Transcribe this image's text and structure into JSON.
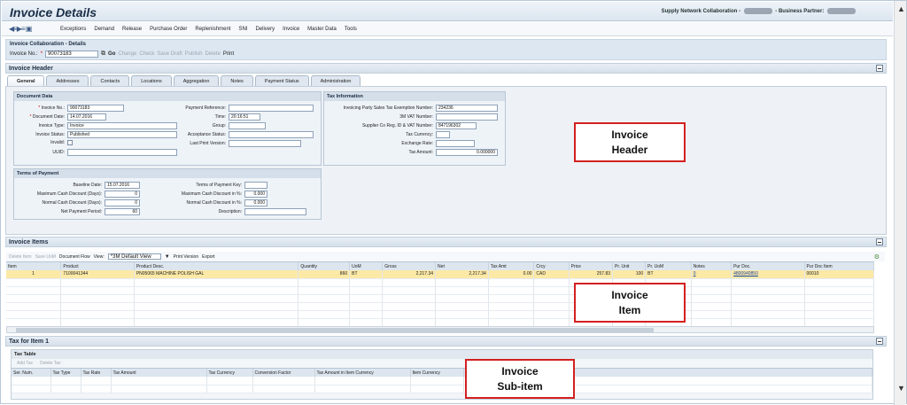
{
  "app": {
    "title": "Invoice Details",
    "snc_label": "Supply Network Collaboration -",
    "bp_label": "- Business Partner:"
  },
  "menu": [
    "Exceptions",
    "Demand",
    "Release",
    "Purchase Order",
    "Replenishment",
    "SNI",
    "Delivery",
    "Invoice",
    "Master Data",
    "Tools"
  ],
  "collab": {
    "header": "Invoice Collaboration - Details",
    "invoice_no_label": "Invoice No.:",
    "invoice_no_value": "90073183",
    "go": "Go",
    "actions": [
      "Change",
      "Check",
      "Save Draft",
      "Publish",
      "Delete"
    ],
    "print": "Print"
  },
  "invoice_header": {
    "title": "Invoice Header",
    "tabs": [
      "General",
      "Addresses",
      "Contacts",
      "Locations",
      "Aggregation",
      "Notes",
      "Payment Status",
      "Administration"
    ],
    "active_tab": "General",
    "document_data": {
      "title": "Document Data",
      "invoice_no_label": "Invoice No.:",
      "invoice_no": "90073183",
      "doc_date_label": "Document Date:",
      "doc_date": "14.07.2016",
      "invoice_type_label": "Invoice Type:",
      "invoice_type": "Invoice",
      "invoice_status_label": "Invoice Status:",
      "invoice_status": "Published",
      "invalid_label": "Invalid:",
      "uuid_label": "UUID:",
      "payment_ref_label": "Payment Reference:",
      "time_label": "Time:",
      "time": "20:16:51",
      "group_label": "Group:",
      "acceptance_label": "Acceptance Status:",
      "last_print_label": "Last Print Version:"
    },
    "tax_information": {
      "title": "Tax Information",
      "exemption_label": "Invoicing Party Sales Tax Exemption Number:",
      "exemption": "234236",
      "vat_label": "3M VAT Number:",
      "supplier_reg_label": "Supplier Co Reg. ID & VAT Number:",
      "supplier_reg": "847196302",
      "tax_currency_label": "Tax Currency:",
      "exchange_label": "Exchange Rate:",
      "tax_amount_label": "Tax Amount:",
      "tax_amount": "0.000000"
    },
    "terms": {
      "title": "Terms of Payment",
      "baseline_label": "Baseline Date:",
      "baseline": "15.07.2016",
      "max_days_label": "Maximum Cash Discount (Days):",
      "max_days": "0",
      "normal_days_label": "Normal Cash Discount (Days):",
      "normal_days": "0",
      "net_period_label": "Net Payment Period:",
      "net_period": "60",
      "key_label": "Terms of Payment Key:",
      "max_pct_label": "Maximum Cash Discount in %:",
      "max_pct": "0.000",
      "normal_pct_label": "Normal Cash Discount in %:",
      "normal_pct": "0.000",
      "desc_label": "Description:"
    },
    "callout": [
      "Invoice",
      "Header"
    ]
  },
  "invoice_items": {
    "title": "Invoice Items",
    "toolbar": {
      "delete_item": "Delete Item",
      "save_uom": "Save UoM",
      "doc_flow": "Document Flow",
      "view_label": "View:",
      "view_value": "*3M Default View",
      "print_version": "Print Version",
      "export": "Export"
    },
    "columns": [
      "Item",
      "Product",
      "Product Desc.",
      "Quantity",
      "UoM",
      "Gross",
      "Net",
      "Tax Amt",
      "Crcy",
      "Price",
      "Pr. Unit",
      "Pr. UoM",
      "Notes",
      "Pur Doc.",
      "Pur Doc Item"
    ],
    "rows": [
      [
        "1",
        "7100041344",
        "PN05065 MACHINE POLISH GAL",
        "860",
        "BT",
        "2,217.34",
        "2,217.34",
        "0.00",
        "CAD",
        "257.83",
        "100",
        "BT",
        "0",
        "4800940850",
        "00010"
      ]
    ],
    "callout": [
      "Invoice",
      "Item"
    ]
  },
  "tax_item": {
    "title": "Tax for Item 1",
    "table_title": "Tax Table",
    "add": "Add Tax",
    "delete": "Delete Tax",
    "columns": [
      "Ser. Num.",
      "Tax Type",
      "Tax Rate",
      "Tax Amount",
      "Tax Currency",
      "Conversion Factor",
      "Tax Amount in Item Currency",
      "Item Currency"
    ],
    "callout": [
      "Invoice",
      "Sub-item"
    ]
  },
  "colors": {
    "callout_border": "#d42020",
    "selected_row": "#fde9a6"
  }
}
